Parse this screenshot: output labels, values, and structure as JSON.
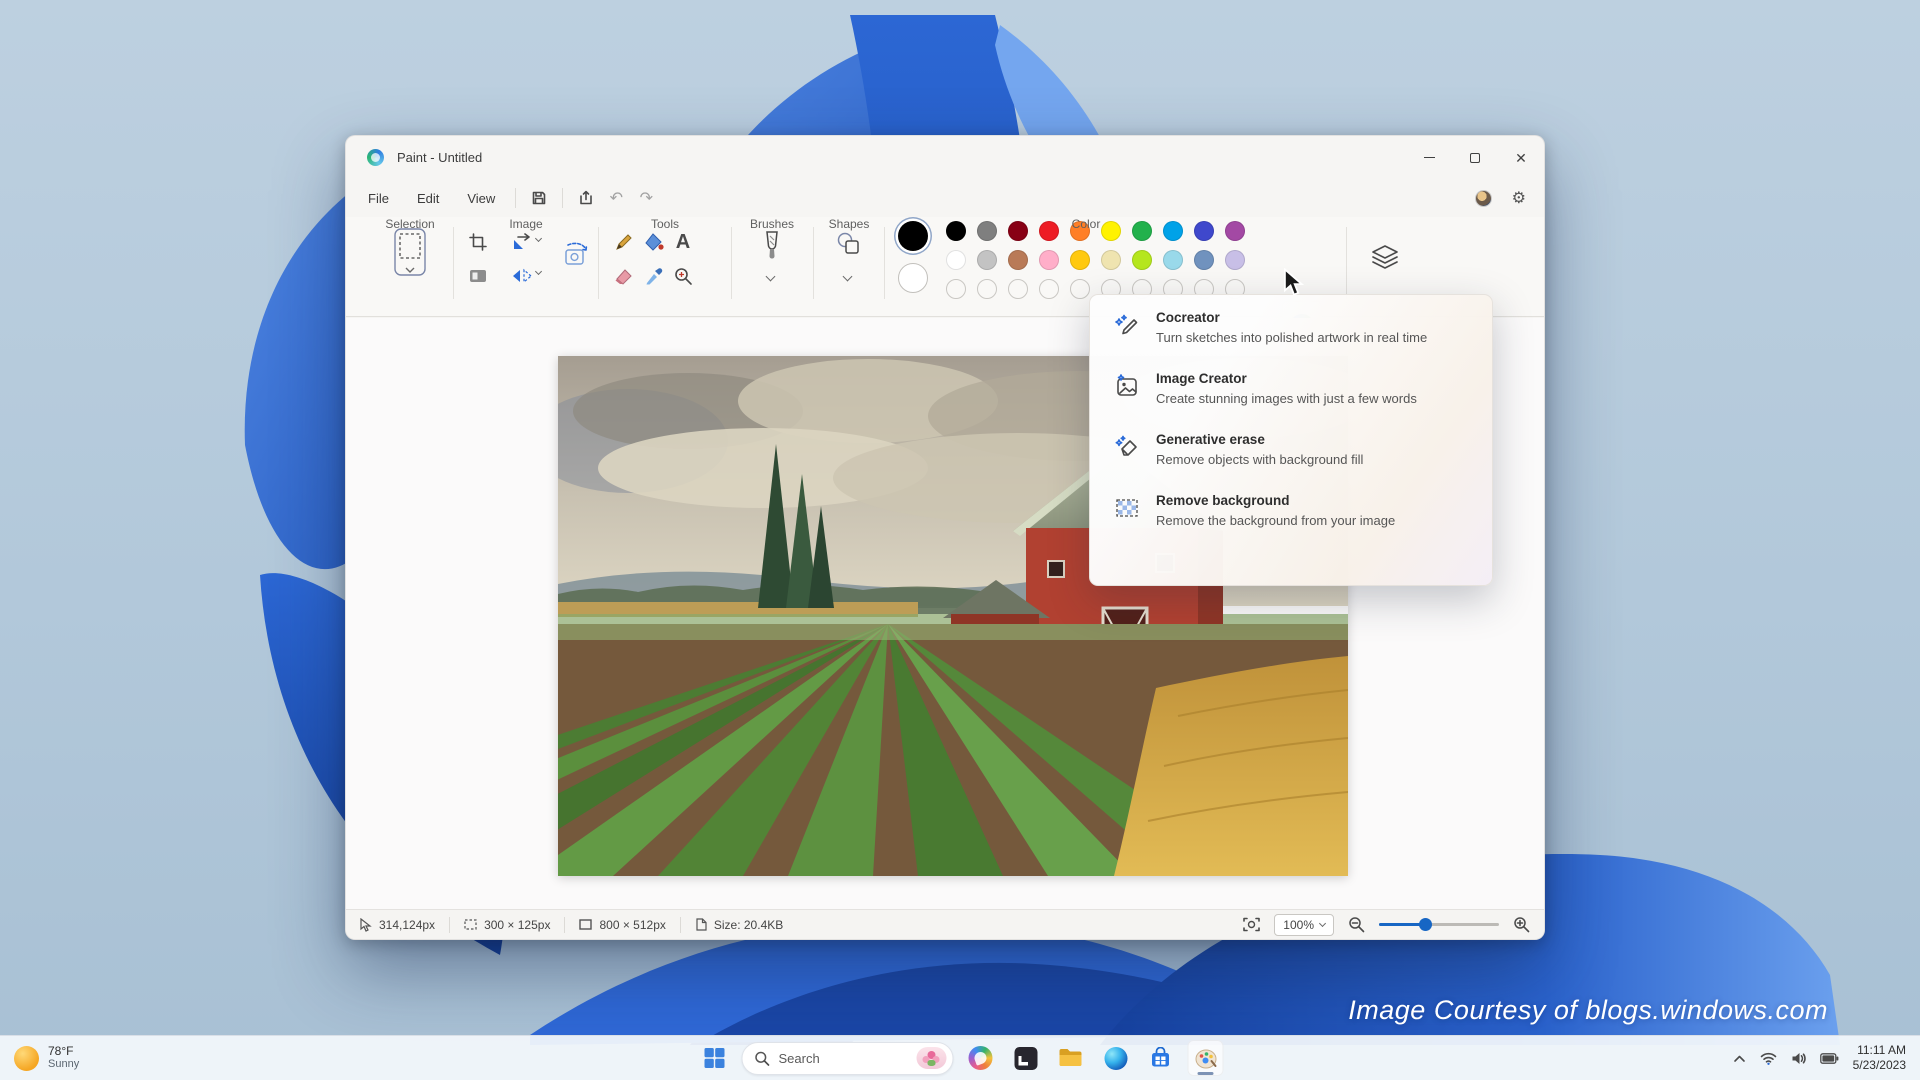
{
  "desktop": {
    "watermark": "Image Courtesy of blogs.windows.com"
  },
  "paint": {
    "title": "Paint - Untitled",
    "menus": {
      "file": "File",
      "edit": "Edit",
      "view": "View"
    },
    "groups": {
      "selection": "Selection",
      "image": "Image",
      "tools": "Tools",
      "brushes": "Brushes",
      "shapes": "Shapes",
      "color": "Color"
    },
    "palette": {
      "color1": "#000000",
      "color2": "#ffffff",
      "row1": [
        "#000000",
        "#7f7f7f",
        "#880015",
        "#ed1c24",
        "#ff7f27",
        "#fff200",
        "#22b14c",
        "#00a2e8",
        "#3f48cc",
        "#a349a4"
      ],
      "row2": [
        "#ffffff",
        "#c3c3c3",
        "#b97a57",
        "#ffaec9",
        "#ffc90e",
        "#efe4b0",
        "#b5e61d",
        "#99d9ea",
        "#7092be",
        "#c8bfe7"
      ],
      "empty_slots": 10
    },
    "copilot_menu": {
      "items": [
        {
          "title": "Cocreator",
          "desc": "Turn sketches into polished artwork in real time"
        },
        {
          "title": "Image Creator",
          "desc": "Create stunning images with just a few words"
        },
        {
          "title": "Generative erase",
          "desc": "Remove objects with background fill"
        },
        {
          "title": "Remove background",
          "desc": "Remove the background from your image"
        }
      ]
    },
    "status": {
      "cursor_pos": "314,124px",
      "selection_size": "300 × 125px",
      "canvas_size": "800 × 512px",
      "file_size": "Size: 20.4KB",
      "zoom_level": "100%"
    }
  },
  "taskbar": {
    "weather": {
      "temp": "78°F",
      "condition": "Sunny"
    },
    "search": {
      "placeholder": "Search"
    },
    "clock": {
      "time": "11:11 AM",
      "date": "5/23/2023"
    }
  }
}
